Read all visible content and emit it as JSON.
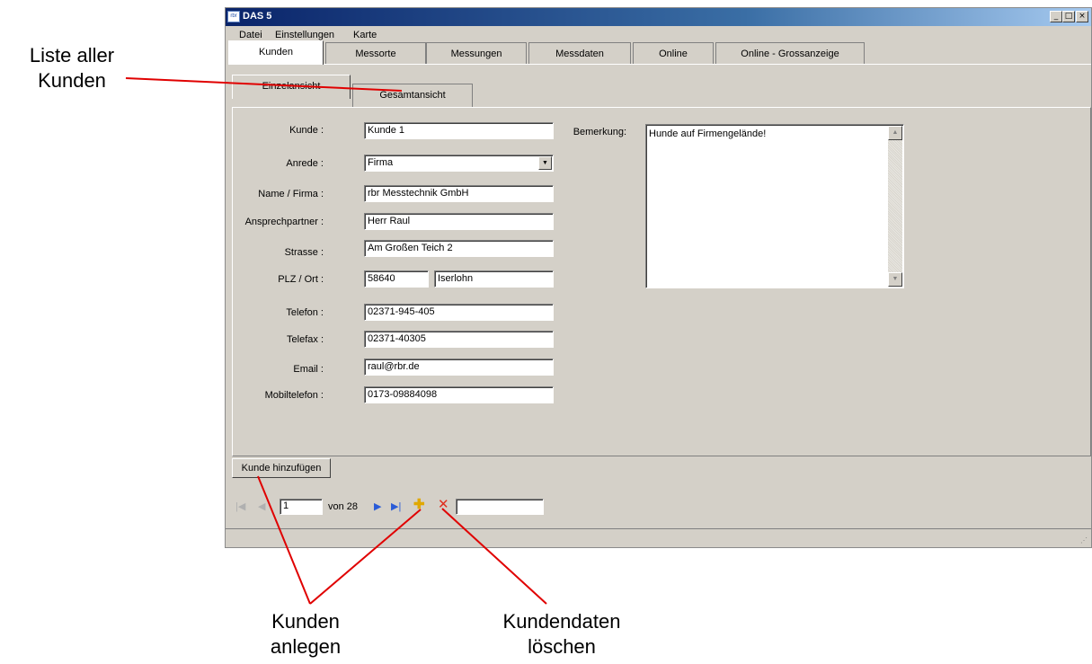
{
  "window": {
    "title": "DAS 5",
    "icon_label": "rbr",
    "controls": {
      "minimize": "_",
      "maximize": "□",
      "close": "×"
    }
  },
  "menu": [
    "Datei",
    "Einstellungen",
    "Karte"
  ],
  "tabs": [
    "Kunden",
    "Messorte",
    "Messungen",
    "Messdaten",
    "Online",
    "Online - Grossanzeige"
  ],
  "subtabs": [
    "Einzelansicht",
    "Gesamtansicht"
  ],
  "form": {
    "kunde": {
      "label": "Kunde :",
      "value": "Kunde 1"
    },
    "anrede": {
      "label": "Anrede :",
      "value": "Firma"
    },
    "name": {
      "label": "Name / Firma :",
      "value": "rbr Messtechnik GmbH"
    },
    "ansprechpartner": {
      "label": "Ansprechpartner :",
      "value": "Herr Raul"
    },
    "strasse": {
      "label": "Strasse :",
      "value": "Am Großen Teich 2"
    },
    "plzort": {
      "label": "PLZ / Ort :",
      "plz": "58640",
      "ort": "Iserlohn"
    },
    "telefon": {
      "label": "Telefon :",
      "value": "02371-945-405"
    },
    "telefax": {
      "label": "Telefax :",
      "value": "02371-40305"
    },
    "email": {
      "label": "Email :",
      "value": "raul@rbr.de"
    },
    "mobil": {
      "label": "Mobiltelefon :",
      "value": "0173-09884098"
    },
    "bemerkung": {
      "label": "Bemerkung:",
      "value": "Hunde auf Firmengelände!"
    }
  },
  "add_button": "Kunde hinzufügen",
  "navigator": {
    "position": "1",
    "of_text": "von 28",
    "search_value": ""
  },
  "annotations": {
    "list": [
      "Liste aller",
      "Kunden"
    ],
    "create": [
      "Kunden",
      "anlegen"
    ],
    "delete": [
      "Kundendaten",
      "löschen"
    ]
  }
}
